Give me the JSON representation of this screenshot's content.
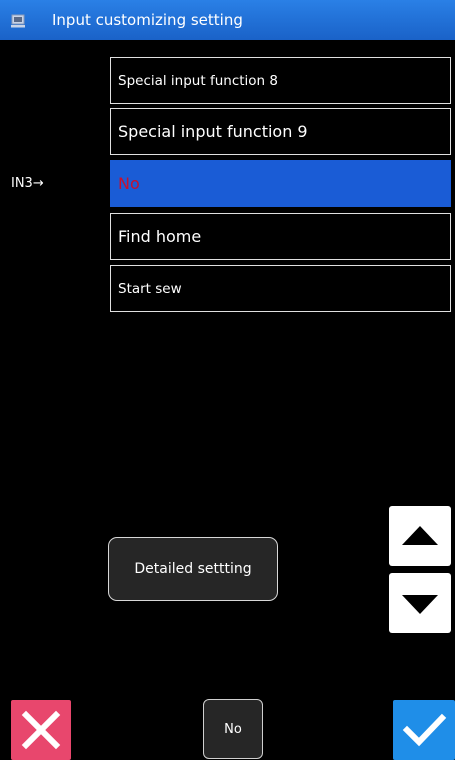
{
  "header": {
    "title": "Input customizing setting",
    "icon": "device-icon"
  },
  "list": {
    "items": [
      {
        "label": "Special input function 8"
      },
      {
        "label": "Special input function 9"
      },
      {
        "label": "No",
        "selected": true
      },
      {
        "label": "Find home"
      },
      {
        "label": "Start sew"
      }
    ],
    "input_label": "IN3→"
  },
  "buttons": {
    "detailed_setting": "Detailed settting",
    "current_value": "No",
    "scroll_up_icon": "triangle-up-icon",
    "scroll_down_icon": "triangle-down-icon",
    "cancel_icon": "close-icon",
    "confirm_icon": "checkmark-icon"
  },
  "colors": {
    "title_bar": "#1a62c8",
    "selected_item_bg": "#1a5cd6",
    "selected_item_text": "#c8102e",
    "cancel": "#e8476d",
    "confirm": "#1f8ee8"
  }
}
